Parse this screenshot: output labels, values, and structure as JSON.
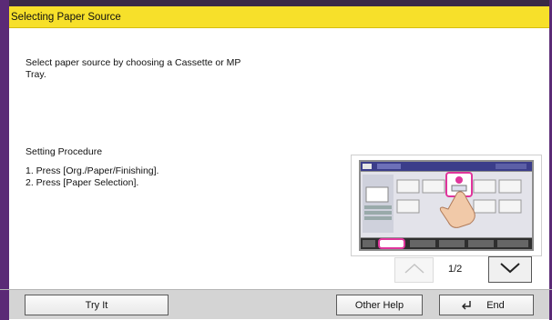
{
  "title": "Selecting Paper Source",
  "description": "Select paper source by choosing a Cassette or MP Tray.",
  "procedure": {
    "title": "Setting Procedure",
    "steps": [
      "1. Press [Org./Paper/Finishing].",
      "2. Press [Paper Selection]."
    ]
  },
  "pagination": {
    "indicator": "1/2",
    "up_icon": "chevron-up-icon",
    "down_icon": "chevron-down-icon"
  },
  "buttons": {
    "try_it": "Try It",
    "other_help": "Other Help",
    "end": "End"
  },
  "colors": {
    "title_bar": "#f7e02a",
    "frame": "#5b2a76",
    "bottom_bar": "#d4d4d4",
    "highlight": "#e0359c"
  }
}
